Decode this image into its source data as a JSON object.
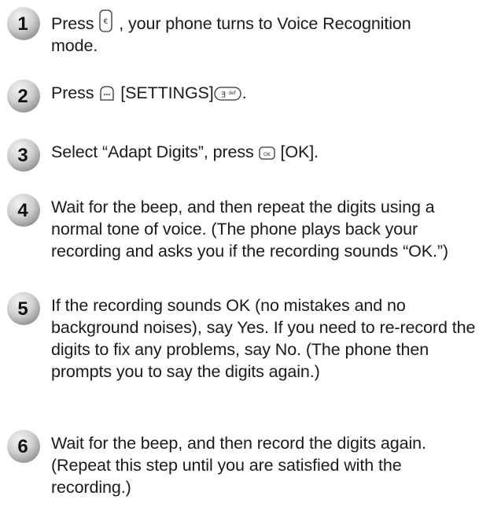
{
  "steps": [
    {
      "number": "1",
      "text_a": "Press",
      "icon": "side-voice-key-icon",
      "text_b": ", your phone turns to Voice Recognition",
      "text_c": "mode."
    },
    {
      "number": "2",
      "text_a": "Press",
      "icon": "left-soft-key-icon",
      "text_b": "[SETTINGS]",
      "icon2": "number-3-def-key-icon",
      "text_c": "."
    },
    {
      "number": "3",
      "text_a": "Select “Adapt Digits”, press",
      "icon": "ok-key-icon",
      "text_b": "[OK]."
    },
    {
      "number": "4",
      "text": "Wait for the beep, and then repeat the digits using a normal tone of voice. (The phone plays back your recording and asks you if the recording sounds “OK.”)"
    },
    {
      "number": "5",
      "text": "If the recording sounds OK (no mistakes and no background noises), say Yes. If you need to re-record the digits to fix any problems, say No. (The phone then prompts you to say the digits again.)"
    },
    {
      "number": "6",
      "text": "Wait for the beep, and then record the digits again. (Repeat this step until you are satisfied with the recording.)"
    }
  ]
}
